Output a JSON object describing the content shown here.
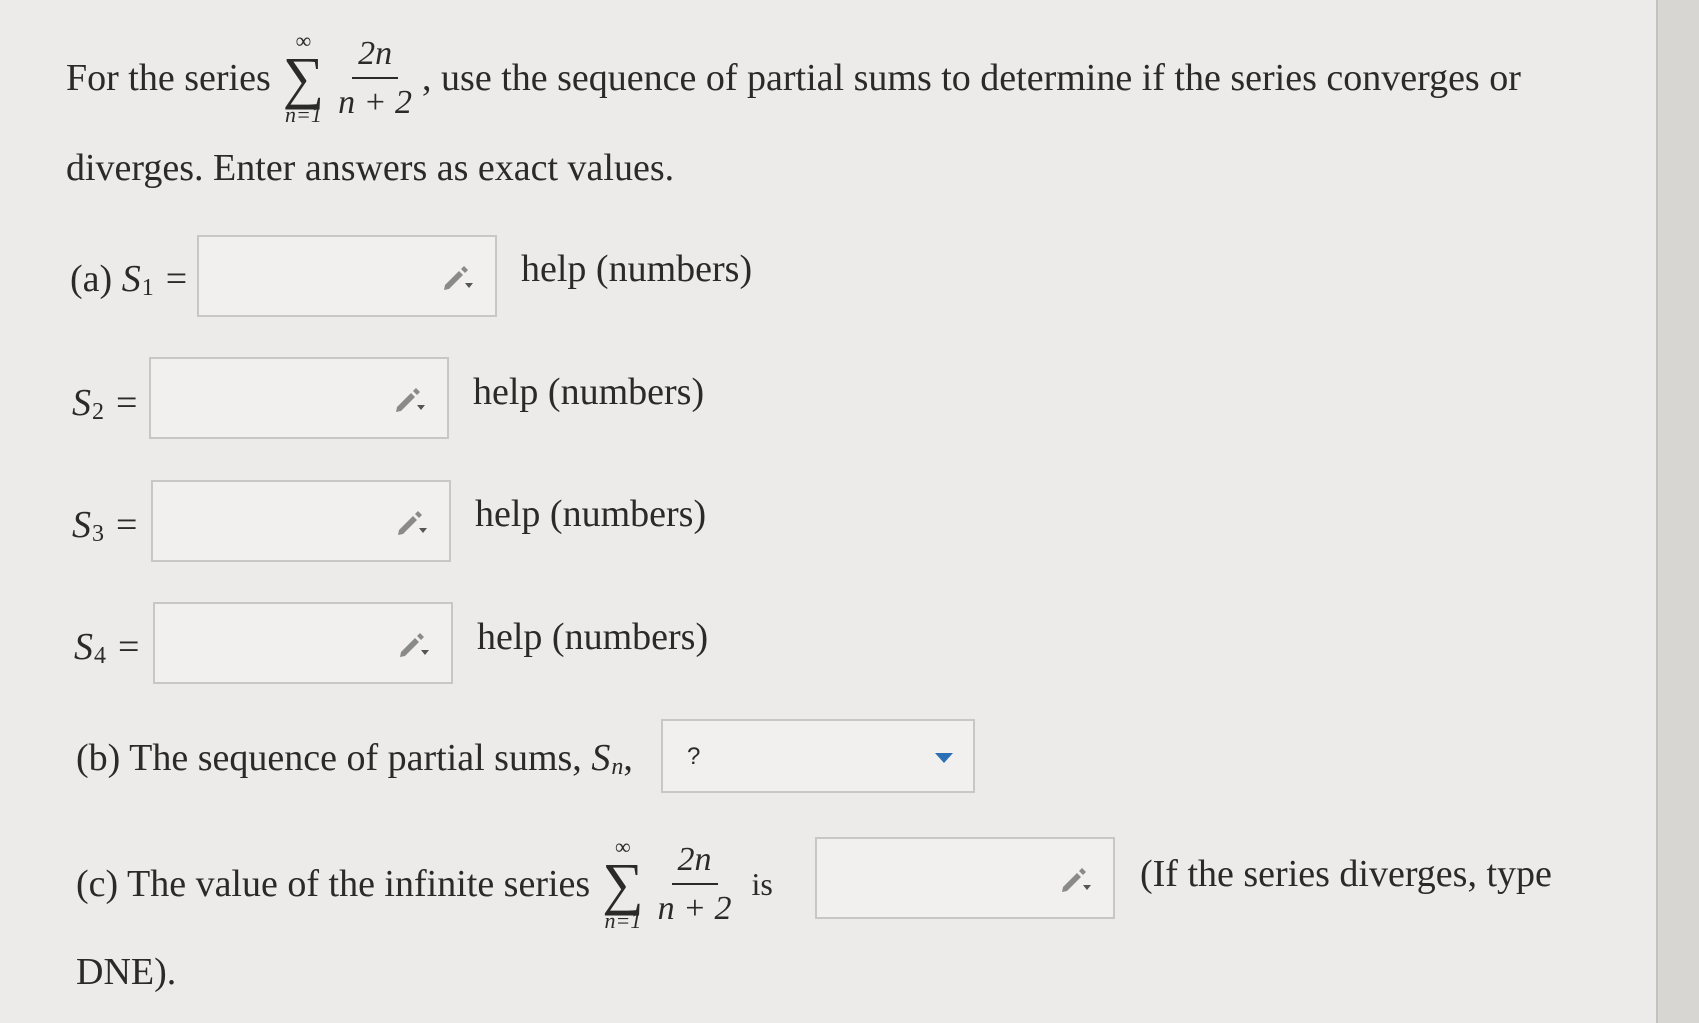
{
  "question": {
    "intro": "For the series",
    "after_sum": ", use the sequence of partial sums to determine if the series converges or",
    "line2": "diverges. Enter answers as exact values."
  },
  "series": {
    "upper": "∞",
    "sigma": "∑",
    "lower": "n=1",
    "numerator": "2n",
    "denominator": "n + 2"
  },
  "part_a": {
    "label": "(a)",
    "rows": [
      {
        "sym": "S",
        "sub": "1",
        "eq": "=",
        "value": "",
        "help": "help (numbers)"
      },
      {
        "sym": "S",
        "sub": "2",
        "eq": "=",
        "value": "",
        "help": "help (numbers)"
      },
      {
        "sym": "S",
        "sub": "3",
        "eq": "=",
        "value": "",
        "help": "help (numbers)"
      },
      {
        "sym": "S",
        "sub": "4",
        "eq": "=",
        "value": "",
        "help": "help (numbers)"
      }
    ]
  },
  "part_b": {
    "text": "(b) The sequence of partial sums,",
    "sym": "S",
    "sub": "n",
    "comma": ",",
    "select_value": "?"
  },
  "part_c": {
    "text": "(c) The value of the infinite series",
    "is": "is",
    "note": "(If the series diverges, type",
    "note2": "DNE)."
  },
  "icons": {
    "edit": "pencil-icon",
    "dropdown": "caret-down-icon"
  },
  "colors": {
    "caret": "#2b6fb5",
    "box_border": "#c9c7c4"
  }
}
